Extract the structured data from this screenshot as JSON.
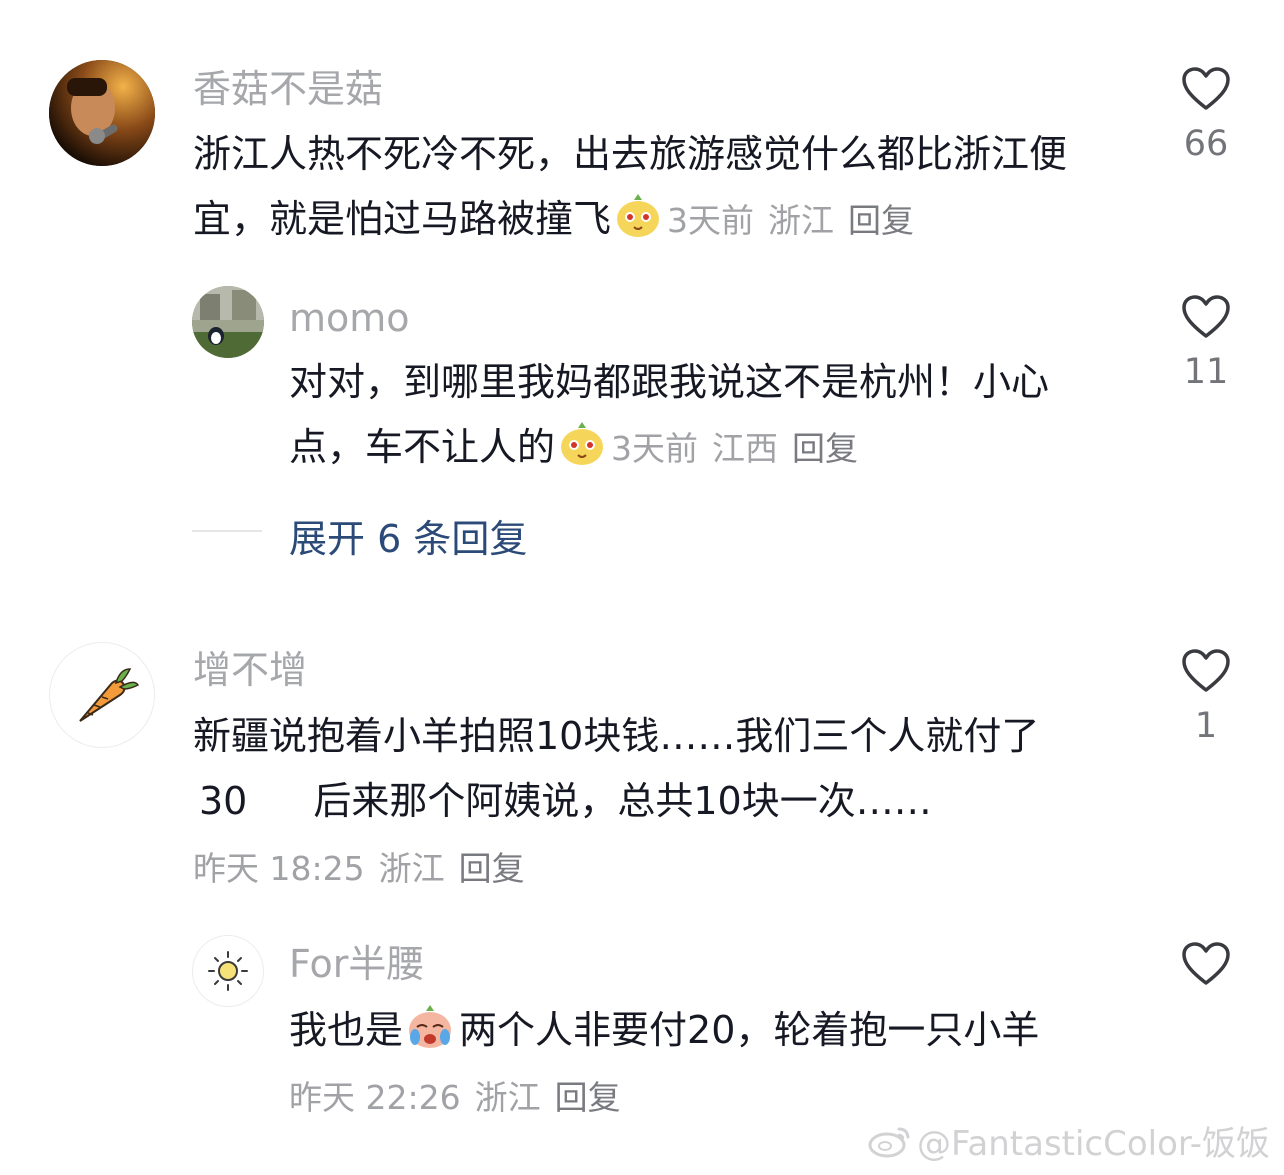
{
  "comments": [
    {
      "user": "香菇不是菇",
      "text_a": "浙江人热不死冷不死，出去旅游感觉什么都比浙江便宜，就是怕过马路被撞飞",
      "time": "3天前",
      "location": "浙江",
      "reply_label": "回复",
      "likes": "66",
      "avatar_icon": "man-with-microphone-avatar",
      "emoji": "pear-face-emoji"
    },
    {
      "user": "momo",
      "text_a": "对对，到哪里我妈都跟我说这不是杭州！小心点，车不让人的",
      "time": "3天前",
      "location": "江西",
      "reply_label": "回复",
      "likes": "11",
      "avatar_icon": "penguin-avatar",
      "emoji": "pear-face-emoji"
    },
    {
      "user": "增不增",
      "text_a": "新疆说抱着小羊拍照10块钱……我们三个人就付了",
      "text_b": "30",
      "text_c": "后来那个阿姨说，总共10块一次……",
      "time": "昨天 18:25",
      "location": "浙江",
      "reply_label": "回复",
      "likes": "1",
      "avatar_icon": "carrot-avatar"
    },
    {
      "user": "For半腰",
      "text_a": "我也是",
      "text_b": "两个人非要付20，轮着抱一只小羊",
      "time": "昨天 22:26",
      "location": "浙江",
      "reply_label": "回复",
      "likes": "",
      "avatar_icon": "sun-avatar",
      "emoji": "crying-face-emoji"
    }
  ],
  "expand": {
    "label": "展开 6 条回复"
  },
  "watermark": "@FantasticColor-饭饭",
  "colors": {
    "link": "#2c4a78",
    "name": "#a6a7ab",
    "meta": "#a1a2a6"
  }
}
